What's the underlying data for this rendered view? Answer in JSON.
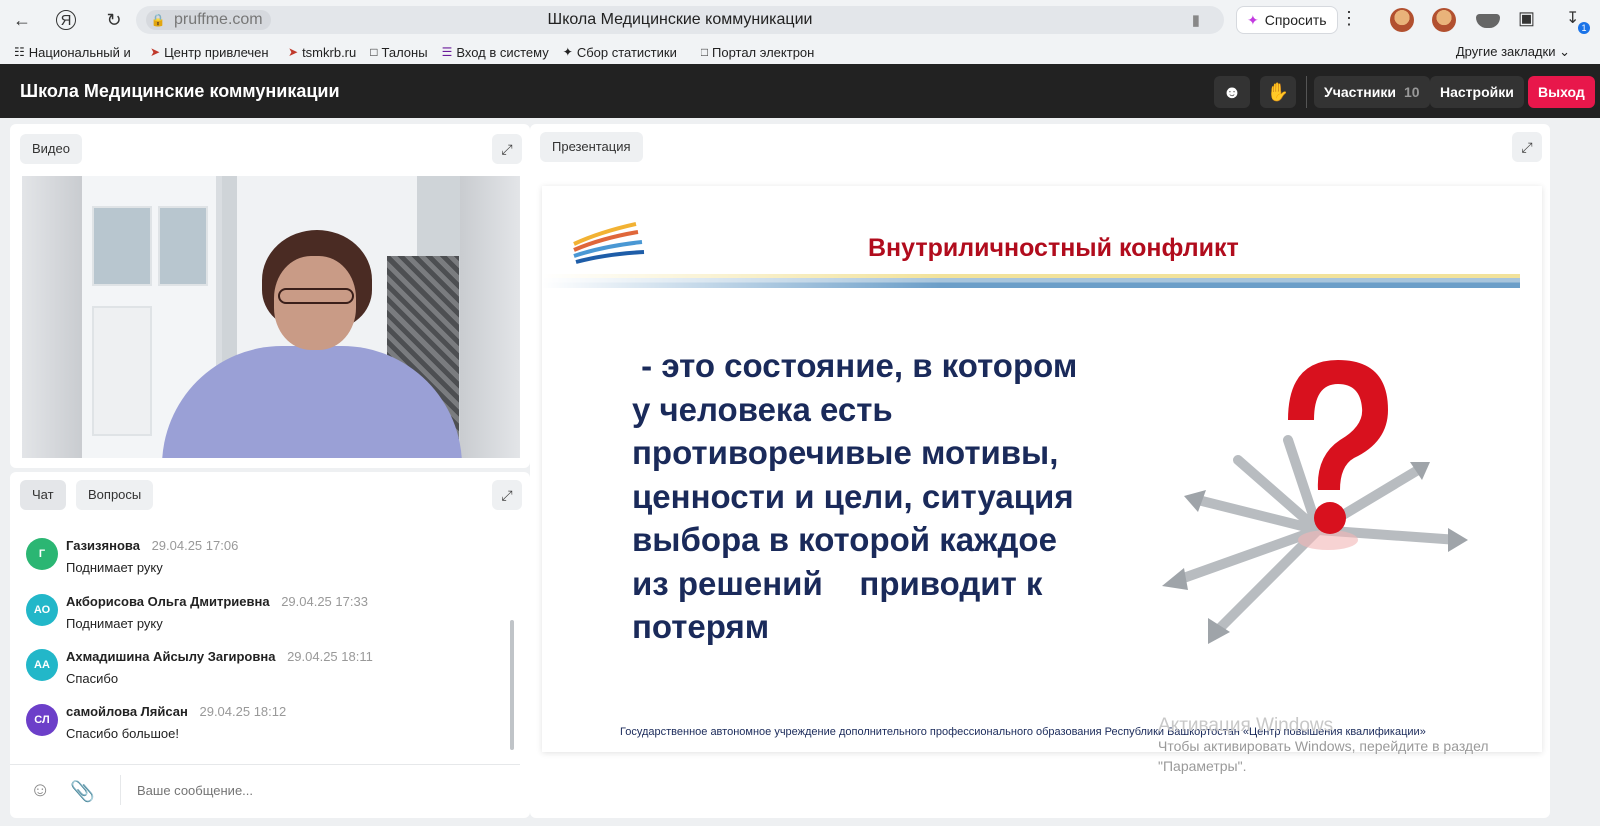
{
  "browser": {
    "url_host": "pruffme.com",
    "tab_title": "Школа Медицинские коммуникации",
    "ask_label": "Спросить",
    "download_badge": "1"
  },
  "bookmarks": {
    "items": [
      {
        "label": "Национальный и",
        "icon": "building-icon"
      },
      {
        "label": "Центр привлечен",
        "icon": "red-arrows-icon"
      },
      {
        "label": "tsmkrb.ru",
        "icon": "red-arrows-icon"
      },
      {
        "label": "Талоны",
        "icon": "page-icon"
      },
      {
        "label": "Вход в систему",
        "icon": "bars-icon"
      },
      {
        "label": "Сбор статистики",
        "icon": "bird-icon"
      },
      {
        "label": "Портал электрон",
        "icon": "page-icon"
      }
    ],
    "other_label": "Другие закладки"
  },
  "header": {
    "title": "Школа Медицинские коммуникации",
    "participants_label": "Участники",
    "participants_count": "10",
    "settings_label": "Настройки",
    "exit_label": "Выход"
  },
  "video_panel": {
    "tab_label": "Видео"
  },
  "chat_panel": {
    "tabs": [
      {
        "label": "Чат"
      },
      {
        "label": "Вопросы"
      }
    ],
    "input_placeholder": "Ваше сообщение...",
    "messages": [
      {
        "initials": "Г",
        "color": "#2bb673",
        "author": "Газизянова",
        "time": "29.04.25 17:06",
        "text": "Поднимает руку"
      },
      {
        "initials": "АО",
        "color": "#22b7c9",
        "author": "Акборисова Ольга Дмитриевна",
        "time": "29.04.25 17:33",
        "text": "Поднимает руку"
      },
      {
        "initials": "АА",
        "color": "#22b7c9",
        "author": "Ахмадишина Айсылу Загировна",
        "time": "29.04.25 18:11",
        "text": "Спасибо"
      },
      {
        "initials": "СЛ",
        "color": "#6c3fc9",
        "author": "самойлова Ляйсан",
        "time": "29.04.25 18:12",
        "text": "Спасибо большое!"
      }
    ]
  },
  "presentation_panel": {
    "tab_label": "Презентация",
    "slide": {
      "title": "Внутриличностный конфликт",
      "lines": [
        " - это состояние, в котором",
        "у человека есть",
        "противоречивые мотивы,",
        "ценности и цели, ситуация",
        "выбора в которой каждое",
        "из решений    приводит к",
        "потерям"
      ],
      "footer": "Государственное автономное учреждение дополнительного профессионального образования Республики Башкортостан «Центр повышения квалификации»"
    }
  },
  "os_watermark": {
    "title": "Активация Windows",
    "line1": "Чтобы активировать Windows, перейдите в раздел",
    "line2": "\"Параметры\"."
  }
}
